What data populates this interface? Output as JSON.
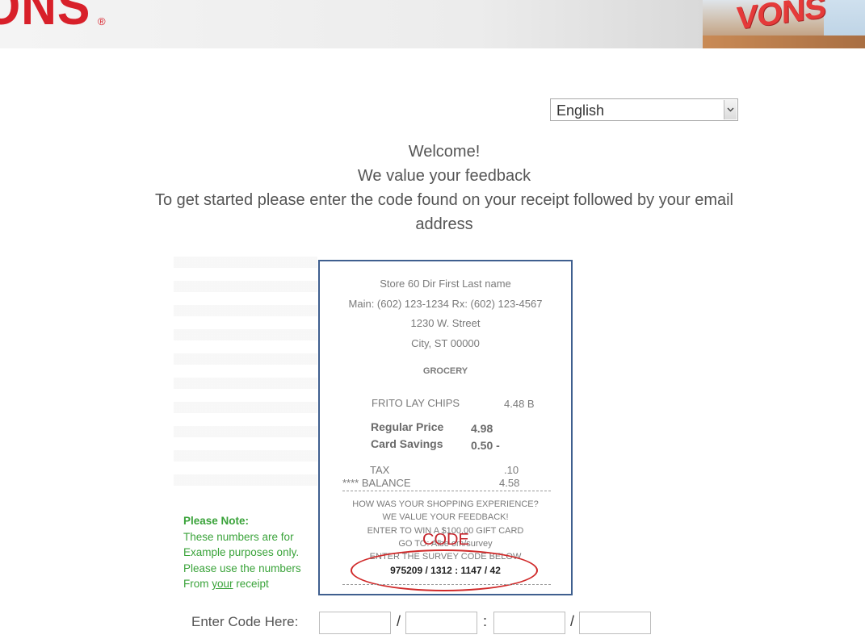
{
  "header": {
    "logo_text": "ONS",
    "registered_mark": "®",
    "store_sign": "VONS"
  },
  "language": {
    "selected": "English"
  },
  "intro": {
    "line1": "Welcome!",
    "line2": "We value your feedback",
    "line3": "To get started please enter the code found on your receipt followed by your email",
    "line4": "address"
  },
  "receipt": {
    "store": "Store 60 Dir First Last name",
    "phones": "Main: (602) 123-1234 Rx: (602) 123-4567",
    "street": "1230 W. Street",
    "city": "City, ST 00000",
    "department": "GROCERY",
    "item_name": "FRITO LAY CHIPS",
    "item_price": "4.48 B",
    "regular_price_label": "Regular  Price",
    "regular_price_value": "4.98",
    "card_savings_label": "Card Savings",
    "card_savings_value": "0.50 -",
    "tax_label": "TAX",
    "tax_value": ".10",
    "balance_label": "**** BALANCE",
    "balance_value": "4.58",
    "survey_line1": "HOW WAS YOUR SHOPPING EXPERIENCE?",
    "survey_line2": "WE VALUE YOUR FEEDBACK!",
    "survey_line3": "ENTER TO WIN A $100.00 GIFT CARD",
    "survey_line4": "GO TO: Albe           om/survey",
    "survey_line5": "ENTER THE SURVEY CODE BELOW",
    "code_label": "CODE",
    "code_value": "975209 / 1312 : 1147 / 42"
  },
  "note": {
    "title": "Please Note:",
    "line1": "These numbers are for",
    "line2": "Example purposes only.",
    "line3": "Please use the numbers",
    "line4_prefix": "From ",
    "line4_underlined": "your",
    "line4_suffix": " receipt"
  },
  "code_entry": {
    "label": "Enter Code Here:",
    "sep1": "/",
    "sep2": ":",
    "sep3": "/",
    "field1": "",
    "field2": "",
    "field3": "",
    "field4": ""
  }
}
